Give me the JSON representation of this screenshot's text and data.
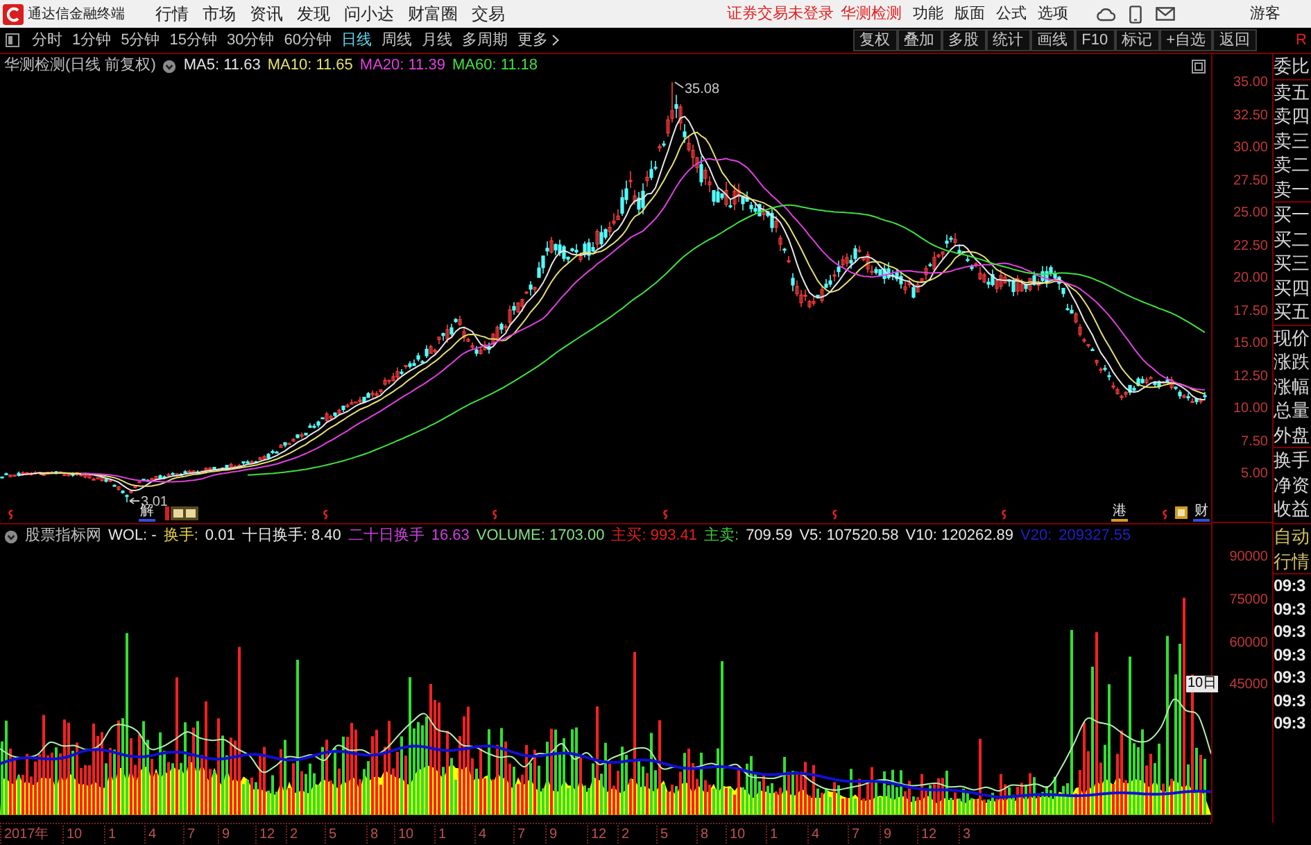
{
  "menu_bar": {
    "app_title": "通达信金融终端",
    "menus": [
      "行情",
      "市场",
      "资讯",
      "发现",
      "问小达",
      "财富圈",
      "交易"
    ],
    "notices": [
      "证券交易未登录",
      "华测检测"
    ],
    "actions": [
      "功能",
      "版面",
      "公式",
      "选项"
    ],
    "user": "游客"
  },
  "toolbar": {
    "periods": [
      {
        "label": "分时",
        "selected": false
      },
      {
        "label": "1分钟",
        "selected": false
      },
      {
        "label": "5分钟",
        "selected": false
      },
      {
        "label": "15分钟",
        "selected": false
      },
      {
        "label": "30分钟",
        "selected": false
      },
      {
        "label": "60分钟",
        "selected": false
      },
      {
        "label": "日线",
        "selected": true
      },
      {
        "label": "周线",
        "selected": false
      },
      {
        "label": "月线",
        "selected": false
      },
      {
        "label": "多周期",
        "selected": false
      },
      {
        "label": "更多",
        "selected": false
      }
    ],
    "tools": [
      "复权",
      "叠加",
      "多股",
      "统计",
      "画线",
      "F10",
      "标记",
      "+自选",
      "返回"
    ],
    "corner": "R"
  },
  "price_chart": {
    "title": "华测检测(日线 前复权)",
    "ma_legend": [
      {
        "text": "MA5: 11.63",
        "color": "#e6e6e6"
      },
      {
        "text": "MA10: 11.65",
        "color": "#e6e070"
      },
      {
        "text": "MA20: 11.39",
        "color": "#e040e0"
      },
      {
        "text": "MA60: 11.18",
        "color": "#40e040"
      }
    ],
    "high_label": "35.08",
    "low_label": "3.01",
    "event_markers": [
      {
        "text": "解",
        "color": "#3050e0"
      },
      {
        "text": "港",
        "color": "#d0a020"
      },
      {
        "text": "财",
        "color": "#3050e0"
      }
    ],
    "y_axis": [
      "35.00",
      "32.50",
      "30.00",
      "27.50",
      "25.00",
      "22.50",
      "20.00",
      "17.50",
      "15.00",
      "12.50",
      "10.00",
      "7.50",
      "5.00"
    ]
  },
  "volume_chart": {
    "title": "股票指标网",
    "legend": [
      {
        "text": "WOL: -",
        "color": "#e6e6e6"
      },
      {
        "text": "换手:",
        "color": "#e6d040"
      },
      {
        "text": "0.01",
        "color": "#e6e6e6"
      },
      {
        "text": "十日换手: 8.40",
        "color": "#e6e6e6"
      },
      {
        "text": "二十日换手",
        "color": "#d040e0"
      },
      {
        "text": "16.63",
        "color": "#d040e0"
      },
      {
        "text": "VOLUME: 1703.00",
        "color": "#80e080"
      },
      {
        "text": "主买: 993.41",
        "color": "#e02020"
      },
      {
        "text": "主卖:",
        "color": "#40d040"
      },
      {
        "text": "709.59",
        "color": "#e6e6e6"
      },
      {
        "text": "V5: 107520.58",
        "color": "#e6e6e6"
      },
      {
        "text": "V10: 120262.89",
        "color": "#e6e6e6"
      },
      {
        "text": "V20:",
        "color": "#2020c0"
      },
      {
        "text": "209327.55",
        "color": "#2020c0"
      }
    ],
    "y_axis": [
      "90000",
      "75000",
      "60000",
      "45000"
    ],
    "badge": "10日"
  },
  "quote_panel": {
    "groups": [
      [
        "委比"
      ],
      [
        "卖五",
        "卖四",
        "卖三",
        "卖二",
        "卖一"
      ],
      [
        "买一",
        "买二",
        "买三",
        "买四",
        "买五"
      ],
      [
        "现价",
        "涨跌",
        "涨幅",
        "总量",
        "外盘"
      ],
      [
        "换手",
        "净资",
        "收益"
      ]
    ]
  },
  "tick_panel": {
    "header": [
      "自动",
      "行情"
    ],
    "times": [
      "09:3",
      "09:3",
      "09:3",
      "09:3",
      "09:3",
      "09:3",
      "09:3"
    ]
  },
  "time_axis": [
    "2017年",
    "10",
    "1",
    "4",
    "7",
    "9",
    "12",
    "2",
    "5",
    "8",
    "10",
    "1",
    "4",
    "7",
    "9",
    "12",
    "2",
    "5",
    "8",
    "10",
    "1",
    "4",
    "7",
    "9",
    "12",
    "3"
  ]
}
